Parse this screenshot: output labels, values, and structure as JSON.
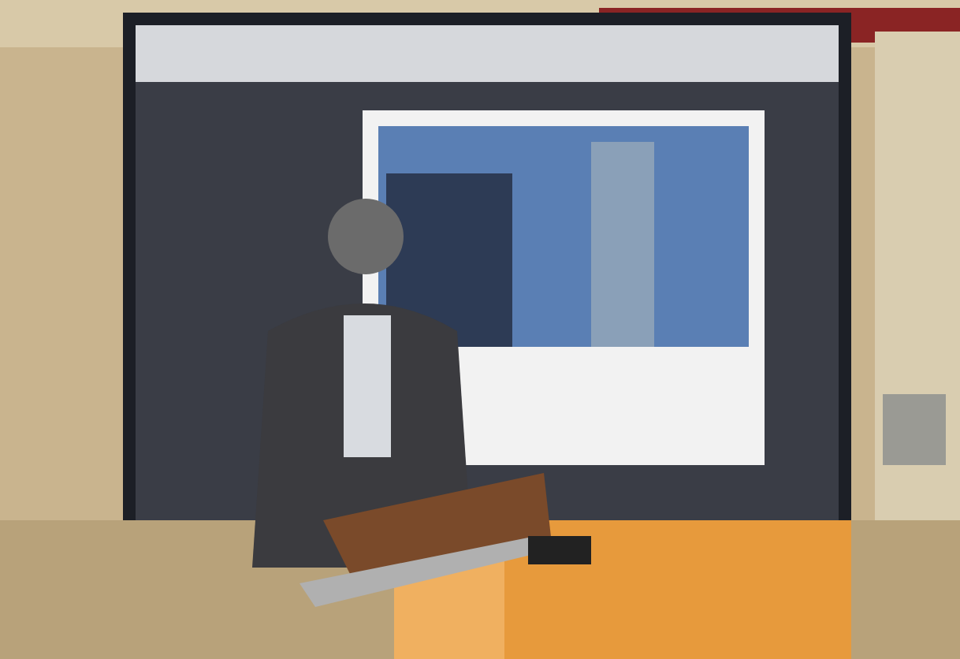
{
  "photo": {
    "kind": "scene"
  }
}
